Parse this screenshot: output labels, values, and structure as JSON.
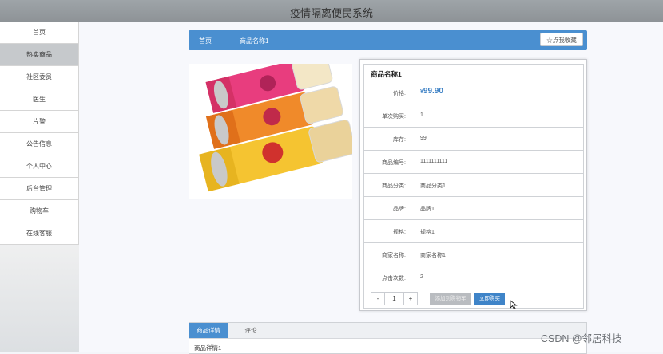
{
  "header": {
    "title": "疫情隔离便民系统"
  },
  "sidebar": {
    "items": [
      {
        "label": "首页"
      },
      {
        "label": "热卖商品"
      },
      {
        "label": "社区委员"
      },
      {
        "label": "医生"
      },
      {
        "label": "片警"
      },
      {
        "label": "公告信息"
      },
      {
        "label": "个人中心"
      },
      {
        "label": "后台管理"
      },
      {
        "label": "购物车"
      },
      {
        "label": "在线客服"
      }
    ]
  },
  "breadcrumb": {
    "home": "首页",
    "current": "商品名称1",
    "favorite_label": "☆点我收藏"
  },
  "product": {
    "name": "商品名称1",
    "price_label": "价格:",
    "currency": "¥",
    "price": "99.90",
    "fields": [
      {
        "label": "单次购买:",
        "value": "1"
      },
      {
        "label": "库存:",
        "value": "99"
      },
      {
        "label": "商品编号:",
        "value": "1111111111"
      },
      {
        "label": "商品分类:",
        "value": "商品分类1"
      },
      {
        "label": "品牌:",
        "value": "品牌1"
      },
      {
        "label": "规格:",
        "value": "规格1"
      },
      {
        "label": "商家名称:",
        "value": "商家名称1"
      },
      {
        "label": "点击次数:",
        "value": "2"
      }
    ],
    "quantity": {
      "minus": "-",
      "value": "1",
      "plus": "+"
    },
    "add_to_cart_label": "添加到购物车",
    "buy_now_label": "立即购买"
  },
  "tabs": {
    "items": [
      {
        "label": "商品详情"
      },
      {
        "label": "评论"
      }
    ],
    "content": "商品详情1"
  },
  "watermark": "CSDN @邻居科技",
  "colors": {
    "accent": "#4a8fd0",
    "price": "#3a7fc4",
    "topbar": "#9ea4a8"
  }
}
